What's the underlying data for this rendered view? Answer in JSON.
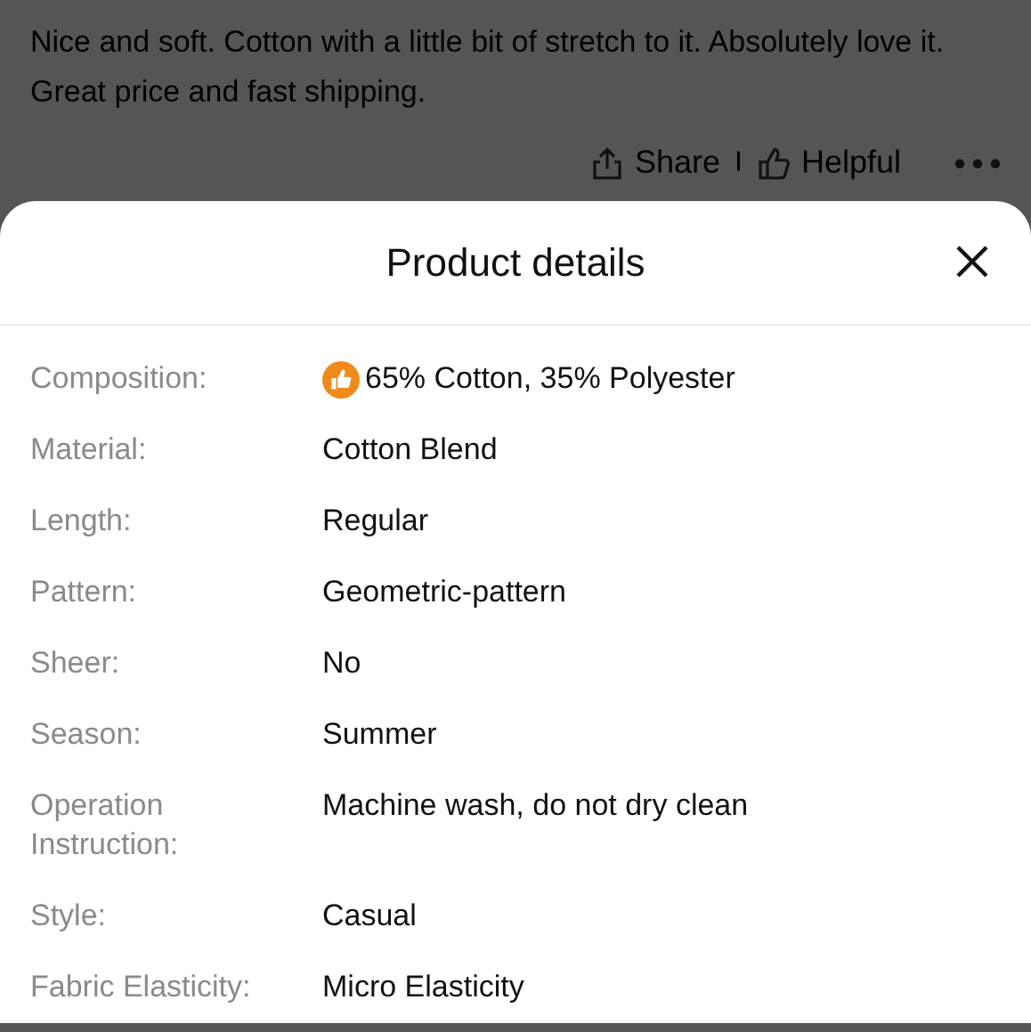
{
  "review": {
    "text": "Nice and soft. Cotton with a little bit of stretch to it. Absolutely love it. Great price and fast shipping.",
    "actions": {
      "share": "Share",
      "separator": "I",
      "helpful": "Helpful"
    }
  },
  "sheet": {
    "title": "Product details",
    "rows": [
      {
        "label": "Composition:",
        "value": "65% Cotton, 35% Polyester",
        "badge": true
      },
      {
        "label": "Material:",
        "value": "Cotton Blend",
        "badge": false
      },
      {
        "label": "Length:",
        "value": "Regular",
        "badge": false
      },
      {
        "label": "Pattern:",
        "value": "Geometric-pattern",
        "badge": false
      },
      {
        "label": "Sheer:",
        "value": "No",
        "badge": false
      },
      {
        "label": "Season:",
        "value": "Summer",
        "badge": false
      },
      {
        "label": "Operation Instruction:",
        "value": "Machine wash, do not dry clean",
        "badge": false
      },
      {
        "label": "Style:",
        "value": "Casual",
        "badge": false
      },
      {
        "label": "Fabric Elasticity:",
        "value": "Micro Elasticity",
        "badge": false
      }
    ]
  }
}
